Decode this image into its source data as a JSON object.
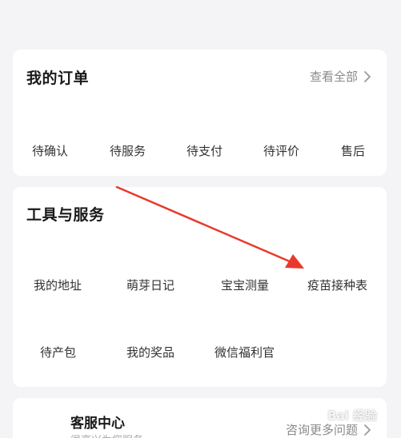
{
  "orders": {
    "title": "我的订单",
    "view_all_label": "查看全部",
    "items": [
      "待确认",
      "待服务",
      "待支付",
      "待评价",
      "售后"
    ]
  },
  "tools": {
    "title": "工具与服务",
    "items": [
      "我的地址",
      "萌芽日记",
      "宝宝测量",
      "疫苗接种表",
      "待产包",
      "我的奖品",
      "微信福利官"
    ]
  },
  "service": {
    "title": "客服中心",
    "subtitle": "很高兴为您服务",
    "more_label": "咨询更多问题"
  },
  "annotation": {
    "arrow_color": "#e8392b"
  },
  "watermark": "Bai 经验"
}
